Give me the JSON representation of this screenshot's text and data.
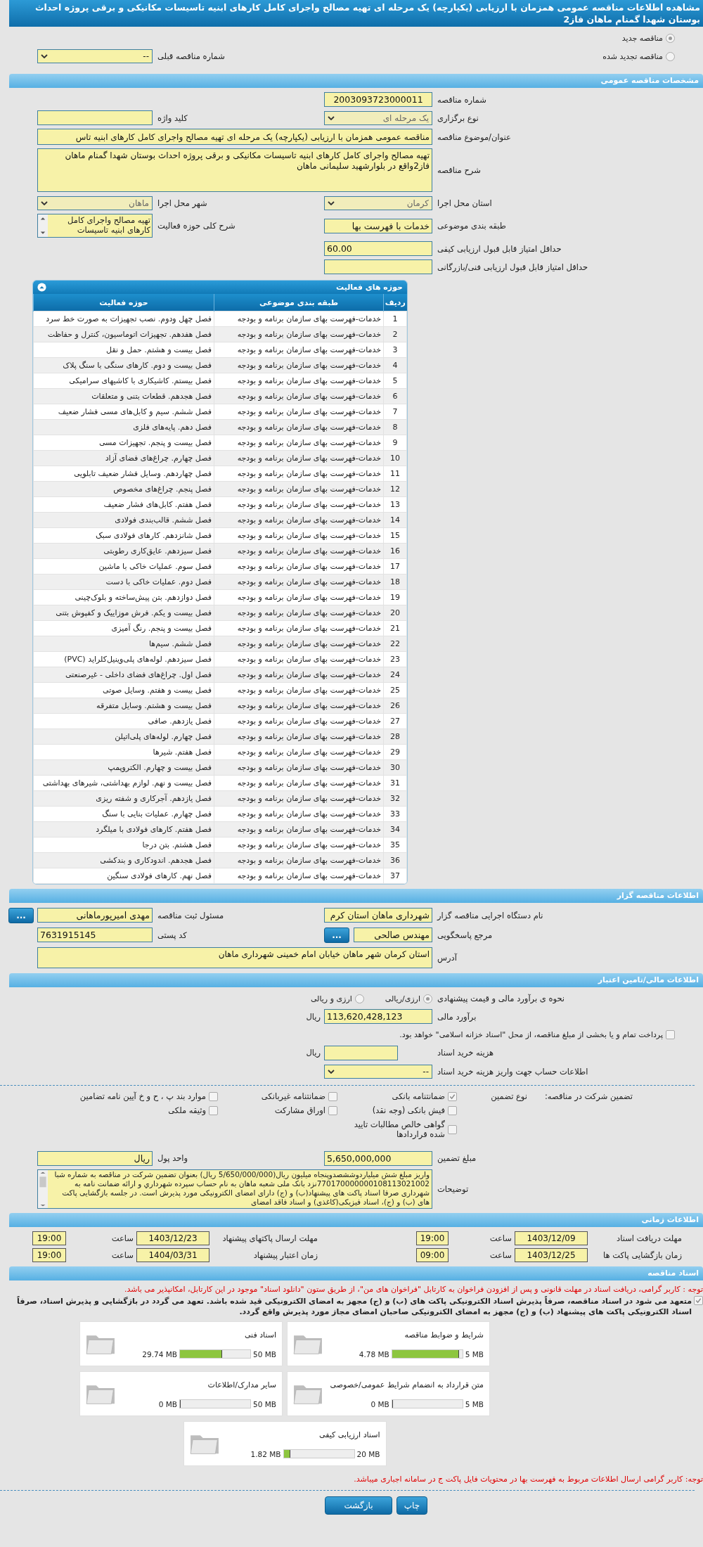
{
  "title": "مشاهده اطلاعات مناقصه عمومی همزمان با ارزیابی (یکپارچه) یک مرحله ای تهیه مصالح واجرای کامل کارهای ابنیه تاسیسات مکانیکی و برقی پروژه احداث بوستان شهدا گمنام ماهان فاز2",
  "tender_status": [
    {
      "label": "مناقصه جدید",
      "selected": true
    },
    {
      "label": "مناقصه تجدید شده",
      "selected": false
    }
  ],
  "previous_tender": {
    "label": "شماره مناقصه قبلی",
    "value": "--"
  },
  "general": {
    "header": "مشخصات مناقصه عمومی",
    "tender_number": {
      "label": "شماره مناقصه",
      "value": "2003093723000011"
    },
    "holding_type": {
      "label": "نوع برگزاری",
      "value": "یک مرحله ای"
    },
    "keyword": {
      "label": "کلید واژه"
    },
    "subject": {
      "label": "عنوان/موضوع مناقصه",
      "value": "مناقصه عمومی همزمان با ارزیابی (یکپارچه) یک مرحله ای تهیه مصالح واجرای کامل کارهای ابنیه تاس"
    },
    "description": {
      "label": "شرح مناقصه",
      "value": "تهیه مصالح واجرای کامل کارهای ابنیه تاسیسات مکانیکی و برقی پروژه احداث بوستان شهدا گمنام ماهان فاز2واقع در بلوارشهید سلیمانی ماهان"
    },
    "province": {
      "label": "استان محل اجرا",
      "value": "کرمان"
    },
    "city": {
      "label": "شهر محل اجرا",
      "value": "ماهان"
    },
    "category": {
      "label": "طبقه بندی موضوعی",
      "value": "خدمات با فهرست بها"
    },
    "activity_scope": {
      "label": "شرح کلی حوزه فعالیت",
      "value": "تهیه مصالح واجرای کامل کارهای ابنیه تاسیسات"
    },
    "min_quality_score": {
      "label": "حداقل امتیاز قابل قبول ارزیابی کیفی",
      "value": "60.00"
    },
    "min_technical_score": {
      "label": "حداقل امتیاز قابل قبول ارزیابی فنی/بازرگانی"
    }
  },
  "activities": {
    "header": "حوزه های فعالیت",
    "columns": [
      "ردیف",
      "طبقه بندی موضوعی",
      "حوزه فعالیت"
    ],
    "rows": [
      [
        "1",
        "خدمات-فهرست بهای سازمان برنامه و بودجه",
        "فصل چهل ودوم. نصب تجهیزات به صورت خط سرد"
      ],
      [
        "2",
        "خدمات-فهرست بهای سازمان برنامه و بودجه",
        "فصل هفدهم. تجهیزات اتوماسیون، کنترل و حفاظت"
      ],
      [
        "3",
        "خدمات-فهرست بهای سازمان برنامه و بودجه",
        "فصل بیست و هشتم. حمل و نقل"
      ],
      [
        "4",
        "خدمات-فهرست بهای سازمان برنامه و بودجه",
        "فصل بیست و دوم. کارهای سنگی با سنگ پلاک"
      ],
      [
        "5",
        "خدمات-فهرست بهای سازمان برنامه و بودجه",
        "فصل بیستم. کاشیکاری با کاشیهای سرامیکی"
      ],
      [
        "6",
        "خدمات-فهرست بهای سازمان برنامه و بودجه",
        "فصل هجدهم. قطعات بتنی و متعلقات"
      ],
      [
        "7",
        "خدمات-فهرست بهای سازمان برنامه و بودجه",
        "فصل ششم. سیم و کابل‌های مسی فشار ضعیف"
      ],
      [
        "8",
        "خدمات-فهرست بهای سازمان برنامه و بودجه",
        "فصل دهم. پایه‌های فلزی"
      ],
      [
        "9",
        "خدمات-فهرست بهای سازمان برنامه و بودجه",
        "فصل بیست و پنجم. تجهیزات مسی"
      ],
      [
        "10",
        "خدمات-فهرست بهای سازمان برنامه و بودجه",
        "فصل چهارم. چراغ‌های فضای آزاد"
      ],
      [
        "11",
        "خدمات-فهرست بهای سازمان برنامه و بودجه",
        "فصل چهاردهم. وسایل فشار ضعیف تابلویی"
      ],
      [
        "12",
        "خدمات-فهرست بهای سازمان برنامه و بودجه",
        "فصل پنجم. چراغ‌های مخصوص"
      ],
      [
        "13",
        "خدمات-فهرست بهای سازمان برنامه و بودجه",
        "فصل هفتم. کابل‌های فشار ضعیف"
      ],
      [
        "14",
        "خدمات-فهرست بهای سازمان برنامه و بودجه",
        "فصل ششم. قالب‌بندی فولادی"
      ],
      [
        "15",
        "خدمات-فهرست بهای سازمان برنامه و بودجه",
        "فصل شانزدهم. کارهای فولادی سبک"
      ],
      [
        "16",
        "خدمات-فهرست بهای سازمان برنامه و بودجه",
        "فصل سیزدهم. عایق‌کاری رطوبتی"
      ],
      [
        "17",
        "خدمات-فهرست بهای سازمان برنامه و بودجه",
        "فصل سوم. عملیات خاکی با ماشین"
      ],
      [
        "18",
        "خدمات-فهرست بهای سازمان برنامه و بودجه",
        "فصل دوم. عملیات خاکی با دست"
      ],
      [
        "19",
        "خدمات-فهرست بهای سازمان برنامه و بودجه",
        "فصل دوازدهم. بتن پیش‌ساخته و بلوک‌چینی"
      ],
      [
        "20",
        "خدمات-فهرست بهای سازمان برنامه و بودجه",
        "فصل بیست و یکم. فرش موزاییک و کفپوش بتنی"
      ],
      [
        "21",
        "خدمات-فهرست بهای سازمان برنامه و بودجه",
        "فصل بیست و پنجم. رنگ آمیزی"
      ],
      [
        "22",
        "خدمات-فهرست بهای سازمان برنامه و بودجه",
        "فصل ششم. سیم‌ها"
      ],
      [
        "23",
        "خدمات-فهرست بهای سازمان برنامه و بودجه",
        "فصل سیزدهم. لوله‌های پلی‌وینیل‌کلراید (PVC)"
      ],
      [
        "24",
        "خدمات-فهرست بهای سازمان برنامه و بودجه",
        "فصل اول. چراغ‌های فضای داخلی - غیرصنعتی"
      ],
      [
        "25",
        "خدمات-فهرست بهای سازمان برنامه و بودجه",
        "فصل بیست و هفتم. وسایل صوتی"
      ],
      [
        "26",
        "خدمات-فهرست بهای سازمان برنامه و بودجه",
        "فصل بیست و هشتم. وسایل متفرقه"
      ],
      [
        "27",
        "خدمات-فهرست بهای سازمان برنامه و بودجه",
        "فصل یازدهم. صافی"
      ],
      [
        "28",
        "خدمات-فهرست بهای سازمان برنامه و بودجه",
        "فصل چهارم. لوله‌های پلی‌اتیلن"
      ],
      [
        "29",
        "خدمات-فهرست بهای سازمان برنامه و بودجه",
        "فصل هفتم. شیرها"
      ],
      [
        "30",
        "خدمات-فهرست بهای سازمان برنامه و بودجه",
        "فصل بیست و چهارم. الکتروپمپ"
      ],
      [
        "31",
        "خدمات-فهرست بهای سازمان برنامه و بودجه",
        "فصل بیست و نهم. لوازم بهداشتی، شیرهای بهداشتی"
      ],
      [
        "32",
        "خدمات-فهرست بهای سازمان برنامه و بودجه",
        "فصل یازدهم. آجرکاری و شفته ریزی"
      ],
      [
        "33",
        "خدمات-فهرست بهای سازمان برنامه و بودجه",
        "فصل چهارم. عملیات بنایی با سنگ"
      ],
      [
        "34",
        "خدمات-فهرست بهای سازمان برنامه و بودجه",
        "فصل هفتم. کارهای فولادی با میلگرد"
      ],
      [
        "35",
        "خدمات-فهرست بهای سازمان برنامه و بودجه",
        "فصل هشتم. بتن درجا"
      ],
      [
        "36",
        "خدمات-فهرست بهای سازمان برنامه و بودجه",
        "فصل هجدهم. اندودکاری و بندکشی"
      ],
      [
        "37",
        "خدمات-فهرست بهای سازمان برنامه و بودجه",
        "فصل نهم. کارهای فولادی سنگین"
      ]
    ]
  },
  "organizer": {
    "header": "اطلاعات مناقصه گزار",
    "agency": {
      "label": "نام دستگاه اجرایی مناقصه گزار",
      "value": "شهرداری ماهان استان کرم"
    },
    "registrar": {
      "label": "مسئول ثبت مناقصه",
      "value": "مهدی امیرپورماهانی",
      "button": "..."
    },
    "reference": {
      "label": "مرجع پاسخگویی",
      "value": "مهندس صالحی",
      "button": "..."
    },
    "postal_code": {
      "label": "کد پستی",
      "value": "7631915145"
    },
    "address": {
      "label": "آدرس",
      "value": "استان کرمان شهر ماهان خیابان امام خمینی شهرداری ماهان"
    }
  },
  "finance": {
    "header": "اطلاعات مالی/تامین اعتبار",
    "estimate_method": {
      "label": "نحوه ی برآورد مالی و قیمت پیشنهادی",
      "options": [
        {
          "label": "ارزی/ریالی",
          "selected": true
        },
        {
          "label": "ارزی و ریالی",
          "selected": false
        }
      ]
    },
    "budget": {
      "label": "برآورد مالی",
      "value": "113,620,428,123",
      "unit": "ریال"
    },
    "treasury": {
      "label": "پرداخت تمام و یا بخشی از مبلغ مناقصه، از محل \"اسناد خزانه اسلامی\" خواهد بود.",
      "checked": false
    },
    "document_fee": {
      "label": "هزینه خرید اسناد",
      "unit": "ریال"
    },
    "account": {
      "label": "اطلاعات حساب جهت واریز هزینه خرید اسناد",
      "value": "--"
    },
    "guarantee": {
      "label": "تضمین شرکت در مناقصه:",
      "type_label": "نوع تضمین",
      "options": [
        {
          "label": "ضمانتنامه بانکی",
          "checked": true
        },
        {
          "label": "ضمانتنامه غیربانکی",
          "checked": false
        },
        {
          "label": "موارد بند پ ، ح و خ آیین نامه تضامین",
          "checked": false
        },
        {
          "label": "فیش بانکی (وجه نقد)",
          "checked": false
        },
        {
          "label": "اوراق مشارکت",
          "checked": false
        },
        {
          "label": "وثیقه ملکی",
          "checked": false
        },
        {
          "label": "گواهی خالص مطالبات تایید شده قراردادها",
          "checked": false
        }
      ]
    },
    "guarantee_amount": {
      "label": "مبلغ تضمین",
      "value": "5,650,000,000"
    },
    "currency": {
      "label": "واحد پول",
      "value": "ریال"
    },
    "notes": {
      "label": "توضیحات",
      "value": "واریز مبلغ شش میلیاردوششصدوپنجاه میلیون ریال(5/650/000/000 ریال) بعنوان تضمین شرکت در مناقصه به شماره شبا 770170000000108113021002نزد بانک ملی شعبه ماهان به نام حساب سپرده شهرداري و ارائه ضمانت نامه به شهرداری صرفا اسناد پاکت های پیشنهاد(ب) و (ج) دارای امضای الکترونیکی مورد پذیرش است. در جلسه بازگشایی پاکت های (ب) و (ج)، اسناد فیزیکی(کاغذی) و اسناد فاقد امضای"
    }
  },
  "schedule": {
    "header": "اطلاعات زمانی",
    "items": [
      {
        "label": "مهلت دریافت اسناد",
        "date": "1403/12/09",
        "time_label": "ساعت",
        "time": "19:00"
      },
      {
        "label": "مهلت ارسال پاکتهای پیشنهاد",
        "date": "1403/12/23",
        "time_label": "ساعت",
        "time": "19:00"
      },
      {
        "label": "زمان بازگشایی پاکت ها",
        "date": "1403/12/25",
        "time_label": "ساعت",
        "time": "09:00"
      },
      {
        "label": "زمان اعتبار پیشنهاد",
        "date": "1404/03/31",
        "time_label": "ساعت",
        "time": "19:00"
      }
    ]
  },
  "documents": {
    "header": "اسناد مناقصه",
    "notice": "توجه : کاربر گرامی، دریافت اسناد در مهلت قانونی و پس از افزودن فراخوان به کارتابل \"فراخوان های من\"، از طریق ستون \"دانلود اسناد\" موجود در این کارتابل، امکانپذیر می باشد.",
    "commitment": {
      "label": "متعهد می شود در اسناد مناقصه، صرفاً پذیرش اسناد الکترونیکی پاکت های (ب) و (ج) مجهز به امضای الکترونیکی قید شده باشد. تعهد می گردد در بازگشایی و پذیرش اسناد، صرفاً اسناد الکترونیکی پاکت های پیشنهاد (ب) و (ج) مجهز به امضای الکترونیکی صاحبان امضای مجاز مورد پذیرش واقع گردد.",
      "checked": true
    },
    "files": [
      {
        "name": "شرایط و ضوابط مناقصه",
        "used": "4.78 MB",
        "max": "5 MB",
        "level": 0.956
      },
      {
        "name": "اسناد فنی",
        "used": "29.74 MB",
        "max": "50 MB",
        "level": 0.595
      },
      {
        "name": "متن قرارداد به انضمام شرایط عمومی/خصوصی",
        "used": "0 MB",
        "max": "5 MB",
        "level": 0
      },
      {
        "name": "سایر مدارک/اطلاعات",
        "used": "0 MB",
        "max": "50 MB",
        "level": 0
      },
      {
        "name": "اسناد ارزیابی کیفی",
        "used": "1.82 MB",
        "max": "20 MB",
        "level": 0.091
      }
    ],
    "footer_note": "توجه: کاربر گرامی ارسال اطلاعات مربوط به فهرست بها در محتویات فایل پاکت ج در سامانه اجباری میباشد."
  },
  "buttons": [
    "چاپ",
    "بازگشت"
  ]
}
